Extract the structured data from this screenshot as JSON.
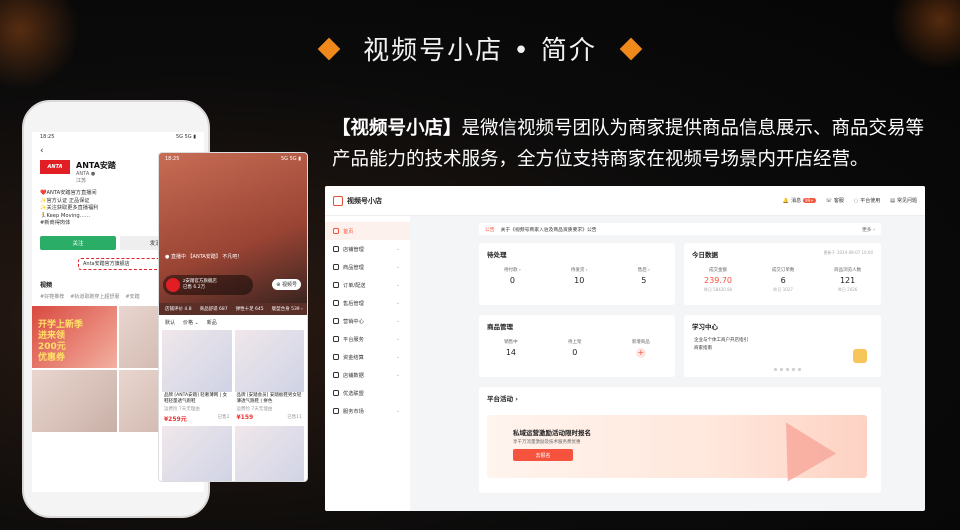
{
  "slide": {
    "title": "视频号小店 • 简介",
    "intro_bold": "【视频号小店】",
    "intro_text": "是微信视频号团队为商家提供商品信息展示、商品交易等产品能力的技术服务，全方位支持商家在视频号场景内开店经营。"
  },
  "colors": {
    "accent": "#f0891c",
    "brand_red": "#f5533d",
    "follow_green": "#2aae67"
  },
  "phone_profile": {
    "time": "18:25",
    "signal": "5G 5G ▮",
    "back": "‹",
    "logo": "ANTA",
    "name": "ANTA安踏",
    "account": "ANTA ●",
    "region": "江苏",
    "desc": [
      "❤️ANTA安踏官方直播间",
      "✨官方认证 正品保证",
      "✨关注获取更多直播福利",
      "🏃Keep Moving……",
      "#新商得肉体"
    ],
    "follow_btn": "关注",
    "other_btn": "发消息",
    "shop_link": "Anta安踏官方旗舰店",
    "tab": "视频",
    "tags": [
      "#好鞋推荐",
      "#轨道取跑穿上超舒服",
      "#安踏"
    ],
    "promo": "开学上新季\n进来领\n200元\n优惠券"
  },
  "phone_live": {
    "time": "18:25",
    "signal": "5G 5G ▮",
    "viewers": "● 直播中   【ANTA安踏】 不凡吧！",
    "anchor_name": "z安踏官方旗舰店",
    "anchor_sub": "已售 6.2万",
    "follow": "⊕ 视频号",
    "stats": [
      "店铺评价 4.8",
      "商品舒适 687",
      "弹性十足 645",
      "版型合身 539 ›"
    ],
    "filters": [
      "默认",
      "价格 ⌄",
      "新品"
    ],
    "products": [
      {
        "title": "品牌 [ANTA安踏] 轻奢薄网 | 女鞋轻量透气跑鞋",
        "sub": "运费险 7天无理由",
        "price": "¥259元",
        "sold": "已售2"
      },
      {
        "title": "品牌 [安踏会员] 安踏板鞋男女轻薄透气跑鞋 | 拼色",
        "sub": "运费险 7天无理由",
        "price": "¥159",
        "sold": "已售11"
      }
    ]
  },
  "admin": {
    "app_name": "视频号小店",
    "top_actions": [
      {
        "label": "消息",
        "badge": "99+"
      },
      {
        "label": "客服"
      },
      {
        "label": "平台使用"
      },
      {
        "label": "常见问题"
      }
    ],
    "sidebar": [
      {
        "label": "首页",
        "active": true
      },
      {
        "label": "店铺管理",
        "chevron": "⌄"
      },
      {
        "label": "商品管理",
        "chevron": "⌄"
      },
      {
        "label": "订单/配送",
        "chevron": "⌄"
      },
      {
        "label": "售后管理",
        "chevron": "⌄"
      },
      {
        "label": "营销中心",
        "chevron": "⌄"
      },
      {
        "label": "平台服务",
        "chevron": "⌄"
      },
      {
        "label": "资金结算",
        "chevron": "⌄"
      },
      {
        "label": "店铺数据",
        "chevron": "⌄"
      },
      {
        "label": "优选联盟"
      },
      {
        "label": "服务市场",
        "chevron": "⌄"
      }
    ],
    "notice": {
      "tag": "公告",
      "text": "关于《视频号商家入驻及商品资质要求》公告",
      "more": "更多 ›"
    },
    "pending": {
      "title": "待处理",
      "items": [
        {
          "label": "待付款 ›",
          "value": "0"
        },
        {
          "label": "待发货 ›",
          "value": "10"
        },
        {
          "label": "售后 ›",
          "value": "5"
        }
      ]
    },
    "today": {
      "title": "今日数据",
      "updated": "更新于 2024-08-07 10:00",
      "items": [
        {
          "label": "成交金额",
          "value": "239.70",
          "sub": "昨日 58420.80"
        },
        {
          "label": "成交订单数",
          "value": "6",
          "sub": "昨日 1027"
        },
        {
          "label": "商品浏览人数",
          "value": "121",
          "sub": "昨日 2026"
        }
      ]
    },
    "goods": {
      "title": "商品管理",
      "items": [
        {
          "label": "销售中",
          "value": "14"
        },
        {
          "label": "待上架",
          "value": "0"
        },
        {
          "label": "新增商品",
          "value": "+"
        }
      ]
    },
    "learn": {
      "title": "学习中心",
      "lines": [
        "企业与个体工商户开店指引",
        "商家指南"
      ]
    },
    "activity": {
      "title": "平台活动 ›",
      "banner_title": "私域运营激励活动限时报名",
      "banner_desc": "享千万流量激励及技术服务费优惠",
      "banner_btn": "去报名"
    }
  }
}
